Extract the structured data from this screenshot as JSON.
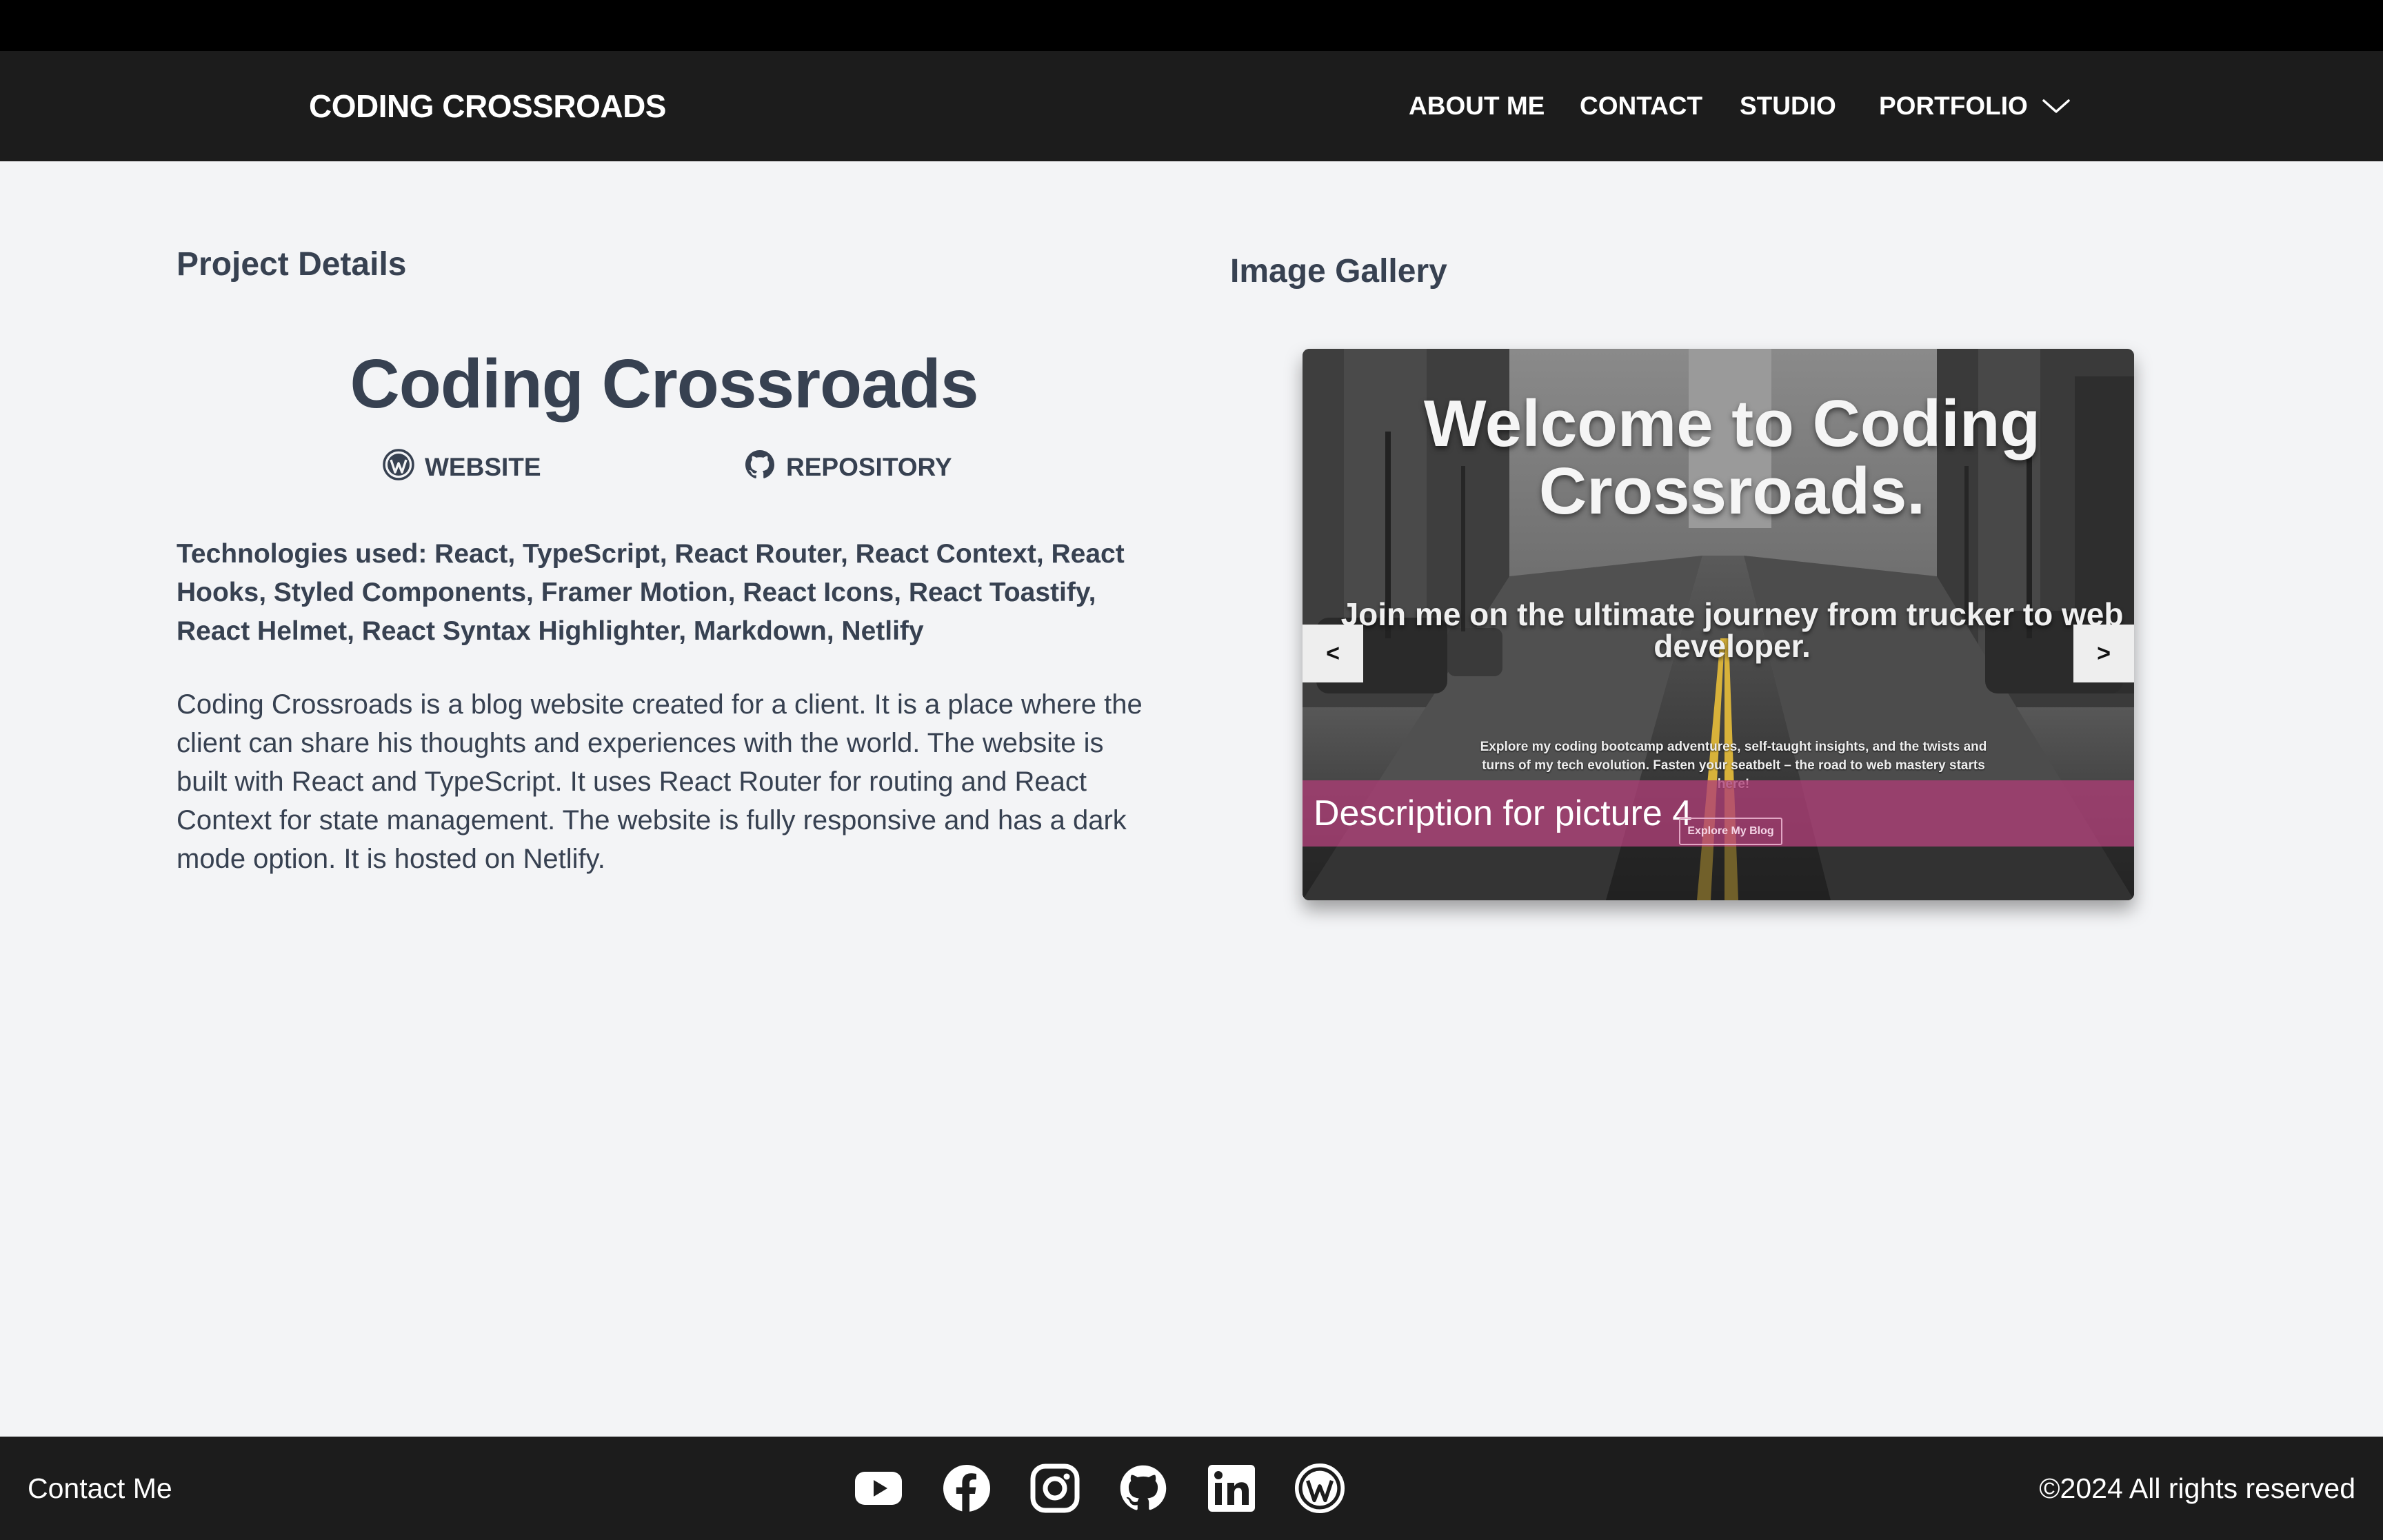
{
  "nav": {
    "brand": "CODING CROSSROADS",
    "links": [
      "ABOUT ME",
      "CONTACT",
      "STUDIO",
      "PORTFOLIO"
    ]
  },
  "project": {
    "section_heading": "Project Details",
    "title": "Coding Crossroads",
    "website_label": "WEBSITE",
    "repository_label": "REPOSITORY",
    "technologies": "Technologies used: React, TypeScript, React Router, React Context, React Hooks, Styled Components, Framer Motion, React Icons, React Toastify, React Helmet, React Syntax Highlighter, Markdown, Netlify",
    "description": "Coding Crossroads is a blog website created for a client. It is a place where the client can share his thoughts and experiences with the world. The website is built with React and TypeScript. It uses React Router for routing and React Context for state management. The website is fully responsive and has a dark mode option. It is hosted on Netlify."
  },
  "gallery": {
    "heading": "Image Gallery",
    "slide_title": "Welcome to Coding Crossroads.",
    "slide_subtitle": "Join me on the ultimate journey from trucker to web developer.",
    "slide_small": "Explore my coding bootcamp adventures, self-taught insights, and the twists and turns of my tech evolution. Fasten your seatbelt – the road to web mastery starts here!",
    "explore_button": "Explore My Blog",
    "caption": "Description for picture 4",
    "prev": "<",
    "next": ">"
  },
  "footer": {
    "contact": "Contact Me",
    "copyright": "©2024 All rights reserved",
    "social_icons": [
      "youtube-icon",
      "facebook-icon",
      "instagram-icon",
      "github-icon",
      "linkedin-icon",
      "wordpress-icon"
    ]
  }
}
